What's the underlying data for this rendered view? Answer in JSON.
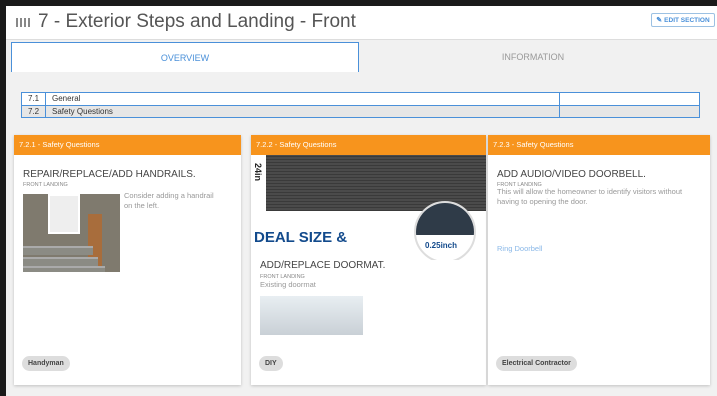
{
  "header": {
    "title": "7 - Exterior Steps and Landing - Front",
    "edit_label": "EDIT SECTION"
  },
  "tabs": [
    {
      "label": "OVERVIEW",
      "active": true
    },
    {
      "label": "INFORMATION",
      "active": false
    }
  ],
  "toc": [
    {
      "num": "7.1",
      "label": "General"
    },
    {
      "num": "7.2",
      "label": "Safety Questions"
    }
  ],
  "cards": [
    {
      "header": "7.2.1 - Safety Questions",
      "title": "REPAIR/REPLACE/ADD HANDRAILS.",
      "location": "FRONT LANDING",
      "text": "Consider adding a handrail on the left.",
      "contractor": "Handyman"
    },
    {
      "header": "7.2.2 - Safety Questions",
      "image_dim": "24in",
      "image_caption": "DEAL SIZE &",
      "image_thickness": "0.25inch",
      "title": "ADD/REPLACE DOORMAT.",
      "location": "FRONT LANDING",
      "text": "Existing doormat",
      "contractor": "DIY"
    },
    {
      "header": "7.2.3 - Safety Questions",
      "title": "ADD AUDIO/VIDEO DOORBELL.",
      "location": "FRONT LANDING",
      "text": "This will allow the homeowner to  identify visitors without having to opening the door.",
      "link": "Ring Doorbell",
      "contractor": "Electrical Contractor"
    }
  ],
  "colors": {
    "accent_orange": "#f7941d",
    "accent_blue": "#4a90d9"
  }
}
